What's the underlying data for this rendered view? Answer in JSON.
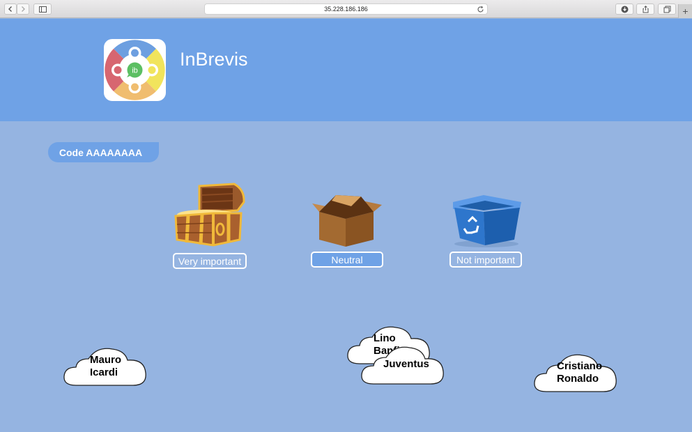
{
  "browser": {
    "url": "35.228.186.186"
  },
  "header": {
    "title": "InBrevis",
    "logo_text": "ib"
  },
  "code_tag": "Code AAAAAAAA",
  "categories": [
    {
      "label": "Very important",
      "icon": "treasure-chest-icon",
      "selected": false
    },
    {
      "label": "Neutral",
      "icon": "cardboard-box-icon",
      "selected": true
    },
    {
      "label": "Not important",
      "icon": "recycle-bin-icon",
      "selected": false
    }
  ],
  "clouds": [
    {
      "line1": "Mauro",
      "line2": "Icardi"
    },
    {
      "line1": "Lino",
      "line2": "Banfi"
    },
    {
      "line1": "Juventus",
      "line2": ""
    },
    {
      "line1": "Cristiano",
      "line2": "Ronaldo"
    }
  ],
  "colors": {
    "background": "#95b4e1",
    "header": "#6fa2e6",
    "button_border": "#ffffff"
  }
}
